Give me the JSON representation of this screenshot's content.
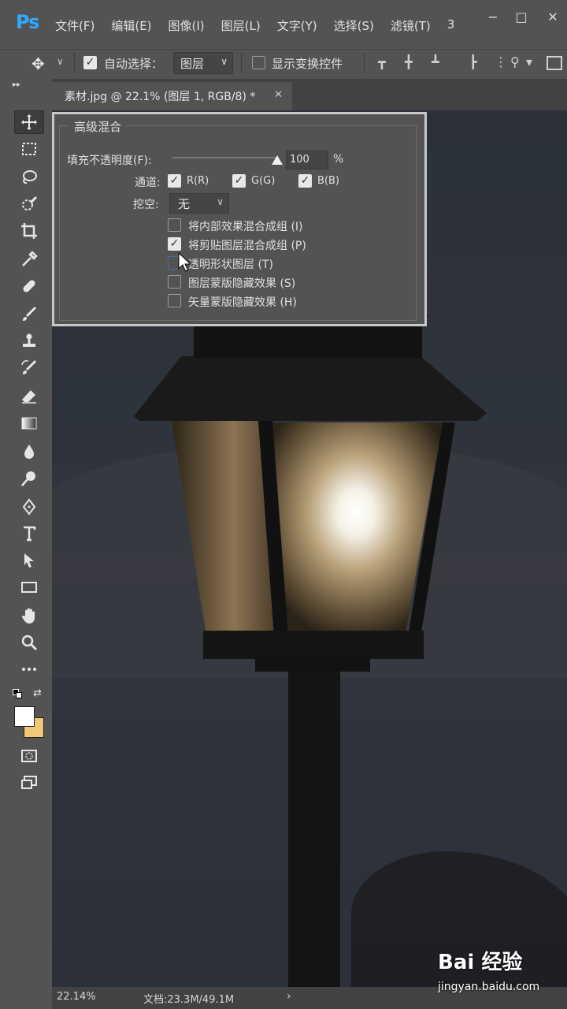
{
  "app": {
    "logo": "Ps"
  },
  "menu": [
    "文件(F)",
    "编辑(E)",
    "图像(I)",
    "图层(L)",
    "文字(Y)",
    "选择(S)",
    "滤镜(T)",
    "3"
  ],
  "window_controls": {
    "minimize": "−",
    "maximize": "□",
    "close": "✕"
  },
  "options": {
    "auto_select_label": "自动选择：",
    "auto_select_checked": true,
    "auto_select_target": "图层",
    "show_transform_label": "显示变换控件",
    "show_transform_checked": false
  },
  "document_tab": {
    "title": "素材.jpg @ 22.1% (图层 1, RGB/8) *",
    "close": "✕"
  },
  "panel": {
    "group_title": "高级混合",
    "fill_opacity_label": "填充不透明度(F):",
    "fill_opacity_value": "100",
    "fill_opacity_unit": "%",
    "fill_opacity_fraction": 1.0,
    "channels_label": "通道:",
    "channels": [
      {
        "label": "R(R)",
        "checked": true
      },
      {
        "label": "G(G)",
        "checked": true
      },
      {
        "label": "B(B)",
        "checked": true
      }
    ],
    "knockout_label": "挖空:",
    "knockout_value": "无",
    "options": [
      {
        "label": "将内部效果混合成组 (I)",
        "checked": false
      },
      {
        "label": "将剪贴图层混合成组 (P)",
        "checked": true
      },
      {
        "label": "透明形状图层 (T)",
        "checked": false
      },
      {
        "label": "图层蒙版隐藏效果 (S)",
        "checked": false
      },
      {
        "label": "矢量蒙版隐藏效果 (H)",
        "checked": false
      }
    ]
  },
  "status": {
    "zoom": "22.14%",
    "doc_info": "文档:23.3M/49.1M",
    "arrow": "›"
  },
  "watermark": {
    "logo": "Bai 经验",
    "url": "jingyan.baidu.com"
  },
  "colors": {
    "foreground": "#ffffff",
    "background": "#f0c878",
    "accent": "#31a8ff"
  }
}
